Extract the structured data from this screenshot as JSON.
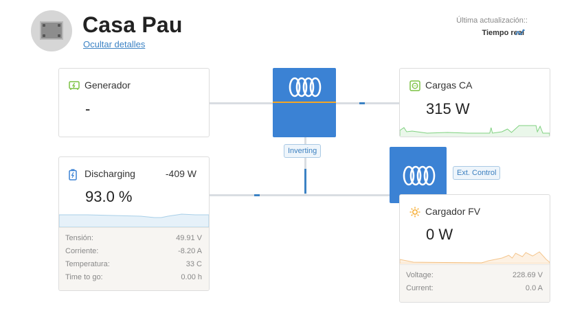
{
  "site": {
    "title": "Casa Pau",
    "hide_details": "Ocultar detalles"
  },
  "update": {
    "label": "Última actualización::",
    "value": "Tiempo real"
  },
  "generator": {
    "label": "Generador",
    "value": "-",
    "icon": "generator-icon"
  },
  "ac_loads": {
    "label": "Cargas CA",
    "value": "315 W",
    "icon": "plug-icon"
  },
  "battery": {
    "label": "Discharging",
    "power": "-409 W",
    "soc": "93.0 %",
    "icon": "battery-icon",
    "details": [
      {
        "label": "Tensión:",
        "value": "49.91 V"
      },
      {
        "label": "Corriente:",
        "value": "-8.20 A"
      },
      {
        "label": "Temperatura:",
        "value": "33 C"
      },
      {
        "label": "Time to go:",
        "value": "0.00 h"
      }
    ]
  },
  "inverter": {
    "state": "Inverting"
  },
  "solar_charger": {
    "state": "Ext. Control",
    "label": "Cargador FV",
    "value": "0 W",
    "icon": "sun-icon",
    "details": [
      {
        "label": "Voltage:",
        "value": "228.69 V"
      },
      {
        "label": "Current:",
        "value": "0.0 A"
      }
    ]
  },
  "colors": {
    "accent": "#3b82d4",
    "link": "#3b82c4",
    "loads_green": "#7fd17f",
    "battery_blue": "#a8cfe8",
    "solar_orange": "#f4c58c",
    "inverter_orange": "#f5a623"
  }
}
